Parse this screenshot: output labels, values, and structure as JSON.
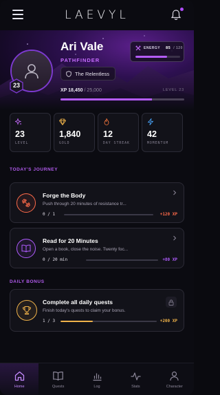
{
  "app": {
    "brand": "LAEVYL"
  },
  "profile": {
    "name": "Ari Vale",
    "class": "PATHFINDER",
    "title": "The Relentless",
    "level": "23",
    "xp_current": "XP 18,450",
    "xp_total": "/ 25,000",
    "xp_fraction": 0.738,
    "level_label": "LEVEL 23"
  },
  "energy": {
    "label": "ENERGY",
    "value": "85",
    "max": "/ 120",
    "fraction": 0.708
  },
  "stats": [
    {
      "value": "23",
      "label": "LEVEL",
      "icon": "sparkle-icon",
      "color": "#c86bff"
    },
    {
      "value": "1,840",
      "label": "GOLD",
      "icon": "gem-icon",
      "color": "#f0b34a"
    },
    {
      "value": "12",
      "label": "DAY STREAK",
      "icon": "flame-icon",
      "color": "#ff7a3d"
    },
    {
      "value": "42",
      "label": "MOMENTUM",
      "icon": "bolt-icon",
      "color": "#4aa8ff"
    }
  ],
  "sections": {
    "journey": "TODAY'S JOURNEY",
    "bonus": "DAILY BONUS"
  },
  "quests": [
    {
      "title": "Forge the Body",
      "desc": "Push through 20 minutes of resistance tr...",
      "progress": "0 / 1",
      "fraction": 0.0,
      "xp": "+120 XP",
      "color": "#ff6b4a",
      "icon": "dumbbell-icon"
    },
    {
      "title": "Read for 20 Minutes",
      "desc": "Open a book, close the noise. Twenty foc...",
      "progress": "0 / 20 min",
      "fraction": 0.0,
      "xp": "+80 XP",
      "color": "#b05cff",
      "icon": "book-icon"
    }
  ],
  "bonus": {
    "title": "Complete all daily quests",
    "desc": "Finish today's quests to claim your bonus.",
    "progress": "1 / 3",
    "fraction": 0.333,
    "xp": "+200 XP",
    "color": "#f0b34a",
    "icon": "trophy-icon",
    "locked_icon": "lock-icon"
  },
  "nav": [
    {
      "label": "Home",
      "icon": "home-icon",
      "active": true
    },
    {
      "label": "Quests",
      "icon": "book-icon",
      "active": false
    },
    {
      "label": "Log",
      "icon": "chart-icon",
      "active": false
    },
    {
      "label": "Stats",
      "icon": "pulse-icon",
      "active": false
    },
    {
      "label": "Character",
      "icon": "user-icon",
      "active": false
    }
  ]
}
